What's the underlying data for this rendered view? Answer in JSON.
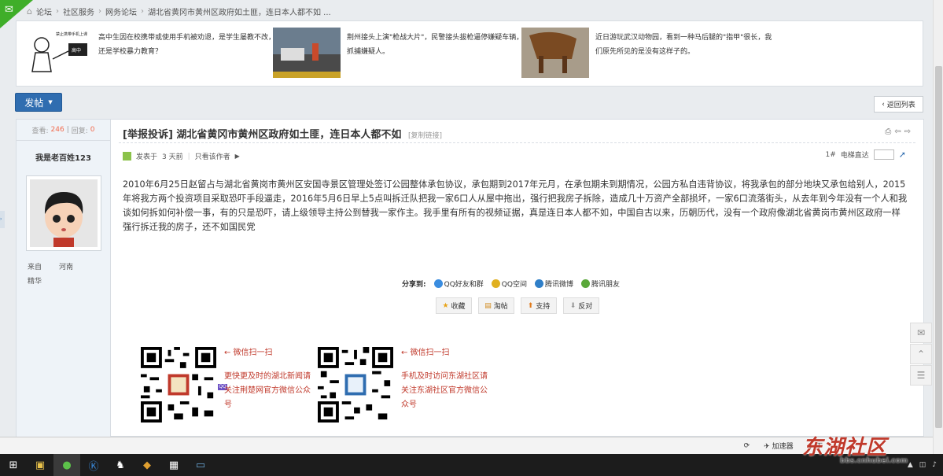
{
  "breadcrumb": {
    "items": [
      "论坛",
      "社区服务",
      "网务论坛",
      "湖北省黄冈市黄州区政府如土匪，连日本人都不如 ..."
    ]
  },
  "news": [
    {
      "text": "高中生因在校携带或使用手机被劝退，是学生屡教不改，还是学校暴力教育？"
    },
    {
      "text": "荆州接头上演\"枪战大片\"，民警接头拔枪逼停嫌疑车辆，抓捕嫌疑人。"
    },
    {
      "text": "近日游玩武汉动物园，看到一种马后腿的\"指甲\"很长，我们原先所见的是没有这样子的。"
    }
  ],
  "toolbar": {
    "post_label": "发帖",
    "back_label": "返回列表"
  },
  "thread": {
    "views_label": "查看:",
    "views": "246",
    "replies_label": "回复:",
    "replies": "0",
    "title": "[举报投诉] 湖北省黄冈市黄州区政府如土匪，连日本人都不如",
    "copy_link": "[复制链接]",
    "posted_prefix": "发表于",
    "posted_time": "3 天前",
    "author_only": "只看该作者",
    "floor_no": "1#",
    "floor_jump": "电梯直达",
    "content": "2010年6月25日赵留占与湖北省黄岗市黄州区安国寺景区管理处签订公园整体承包协议，承包期到2017年元月，在承包期未到期情况，公园方私自违背协议，将我承包的部分地块又承包给别人，2015年将我方两个投资项目采取恐吓手段逼走，2016年5月6日早上5点叫拆迁队把我一家6口人从屋中拖出，强行把我房子拆除，造成几十万资产全部损坏，一家6口流落街头，从去年到今年没有一个人和我谈如何拆如何补偿一事，有的只是恐吓，请上级领导主持公到替我一家作主。我手里有所有的视频证据，真是连日本人都不如，中国自古以来，历朝历代，没有一个政府像湖北省黄岗市黄州区政府一样强行拆迁我的房子，还不如国民党"
  },
  "author": {
    "name": "我是老百姓123",
    "from_label": "来自",
    "from_value": "河南",
    "rank": "精华"
  },
  "share": {
    "label": "分享到:",
    "targets": [
      "QQ好友和群",
      "QQ空间",
      "腾讯微博",
      "腾讯朋友"
    ],
    "colors": [
      "#3a8de0",
      "#e0b020",
      "#2f7fc8",
      "#5aa83a"
    ]
  },
  "actions": [
    "收藏",
    "淘帖",
    "支持",
    "反对"
  ],
  "qr": [
    {
      "arrow": "← 微信扫一扫",
      "text": "更快更及时的湖北新闻请关注荆楚网官方微信公众号"
    },
    {
      "arrow": "← 微信扫一扫",
      "text": "手机及时访问东湖社区请关注东湖社区官方微信公众号"
    }
  ],
  "statusbar": {
    "accelerator": "加速器",
    "download": "下"
  },
  "watermark": {
    "title": "东湖社区",
    "sub": "bbs.cnhubei.com"
  },
  "colors": {
    "accent": "#2f6db0",
    "views": "#f26c4f",
    "qr_text": "#c0392b"
  }
}
